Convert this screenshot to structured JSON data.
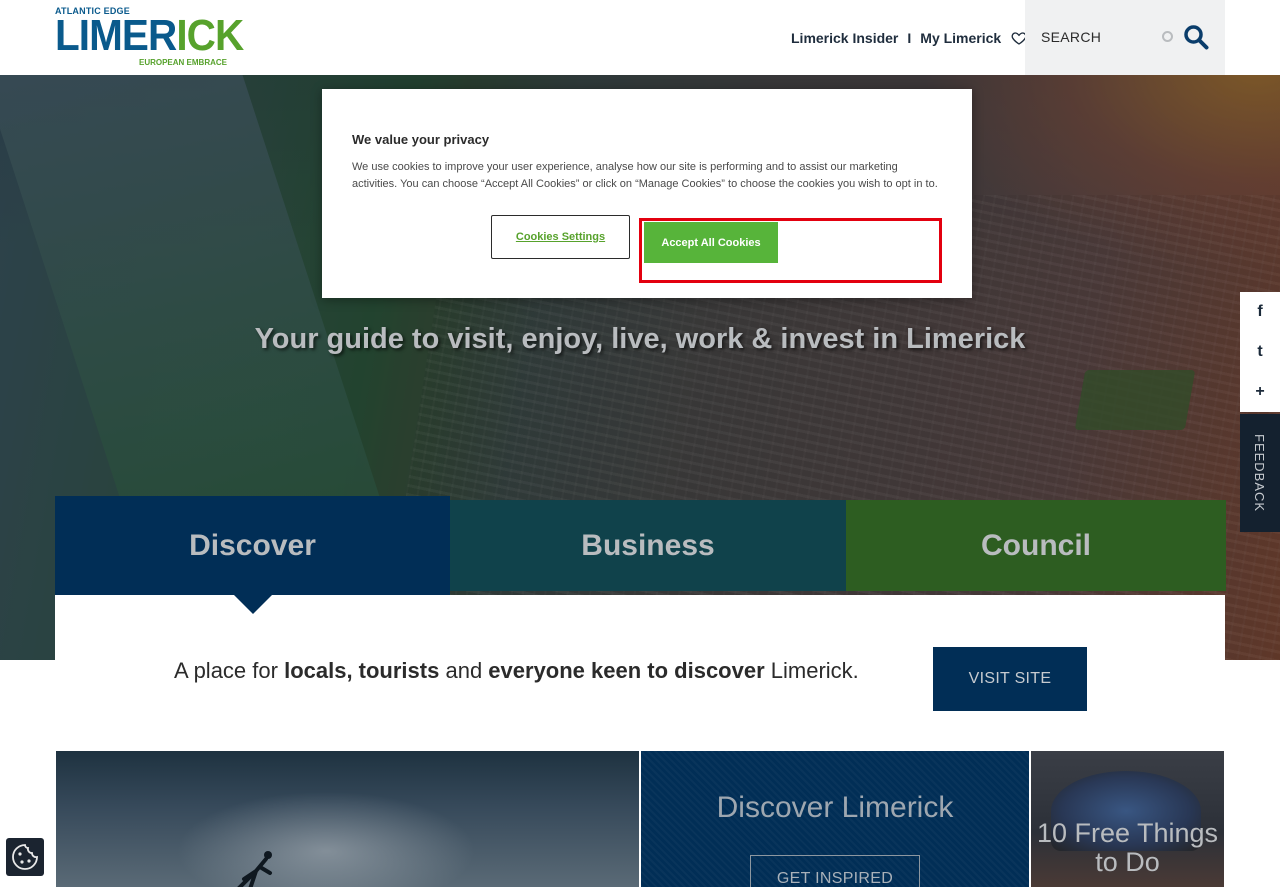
{
  "header": {
    "logo": {
      "top_text": "ATLANTIC EDGE",
      "main_text_part1": "LIMER",
      "main_text_part2": "ICK",
      "bottom_text": "EUROPEAN EMBRACE"
    },
    "nav": {
      "insider_label": "Limerick Insider",
      "separator": "I",
      "my_limerick_label": "My Limerick"
    },
    "search": {
      "label": "SEARCH"
    }
  },
  "hero": {
    "tagline": "Your guide to visit, enjoy, live, work & invest in Limerick"
  },
  "social": {
    "facebook_glyph": "f",
    "twitter_glyph": "t",
    "more_glyph": "+"
  },
  "feedback_label": "FEEDBACK",
  "tabs": {
    "discover": "Discover",
    "business": "Business",
    "council": "Council"
  },
  "intro": {
    "part1": "A place for ",
    "bold1": "locals, tourists",
    "part2": " and ",
    "bold2": "everyone keen to discover",
    "part3": " Limerick.",
    "visit_button": "VISIT SITE"
  },
  "cards": {
    "discover_title": "Discover Limerick",
    "discover_button": "GET INSPIRED",
    "free_things_title": "10 Free Things to Do"
  },
  "cookie_modal": {
    "heading": "We value your privacy",
    "body": "We use cookies to improve your user experience, analyse how our site is performing and to assist our marketing activities. You can choose “Accept All Cookies” or click on “Manage Cookies” to choose the cookies you wish to opt in to.",
    "settings_button": "Cookies Settings",
    "accept_button": "Accept All Cookies"
  },
  "colors": {
    "brand_blue": "#012e56",
    "brand_green": "#57a22c",
    "business_teal": "#10424b",
    "council_green": "#2d5d21",
    "accept_green": "#57b43a",
    "highlight_red": "#e3000f"
  },
  "icons": {
    "heart": "heart-icon",
    "search": "search-icon",
    "loading": "loading-spinner-icon",
    "cookie": "cookie-icon"
  }
}
